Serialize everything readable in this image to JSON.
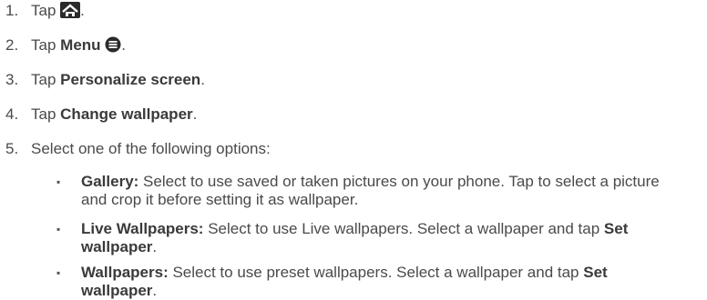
{
  "steps": [
    {
      "number": "1.",
      "prefix": "Tap",
      "icon": "home-icon",
      "suffix": "."
    },
    {
      "number": "2.",
      "prefix": "Tap",
      "bold": "Menu",
      "icon": "menu-icon",
      "suffix": "."
    },
    {
      "number": "3.",
      "prefix": "Tap",
      "bold": "Personalize screen",
      "suffix": "."
    },
    {
      "number": "4.",
      "prefix": "Tap",
      "bold": "Change wallpaper",
      "suffix": "."
    },
    {
      "number": "5.",
      "text": "Select one of the following options:"
    }
  ],
  "options": [
    {
      "bullet": "▪",
      "title": "Gallery:",
      "text": " Select to use saved or taken pictures on your phone. Tap to select a picture and crop it before setting it as wallpaper."
    },
    {
      "bullet": "▪",
      "title": "Live Wallpapers:",
      "text": " Select to use Live wallpapers. Select a wallpaper and tap ",
      "action": "Set wallpaper",
      "suffix": "."
    },
    {
      "bullet": "▪",
      "title": "Wallpapers:",
      "text": " Select to use preset wallpapers. Select a wallpaper and tap ",
      "action": "Set wallpaper",
      "suffix": "."
    }
  ],
  "colors": {
    "text": "#4a4a4a",
    "icon": "#2b2b2b"
  }
}
